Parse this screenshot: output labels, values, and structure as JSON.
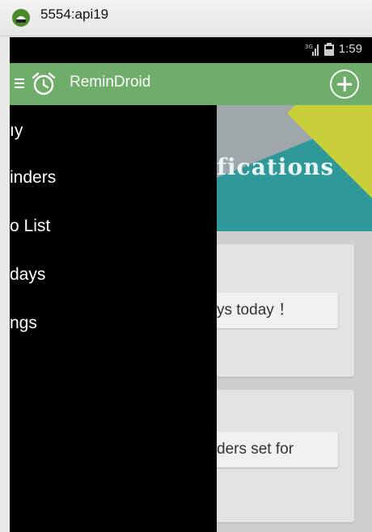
{
  "window": {
    "title": "5554:api19"
  },
  "status_bar": {
    "time": "1:59"
  },
  "action_bar": {
    "title": "ReminDroid"
  },
  "banner": {
    "title": "fications"
  },
  "cards": [
    {
      "text": "ys today ！"
    },
    {
      "text": "ders set for"
    }
  ],
  "drawer": {
    "items": [
      {
        "label": "ıy"
      },
      {
        "label": "inders"
      },
      {
        "label": "o List"
      },
      {
        "label": "days"
      },
      {
        "label": "ngs"
      }
    ]
  },
  "colors": {
    "action_bar": "#6fae6a",
    "drawer": "#000000",
    "banner_teal": "#2f9898",
    "banner_yellow": "#c9cf3a"
  }
}
